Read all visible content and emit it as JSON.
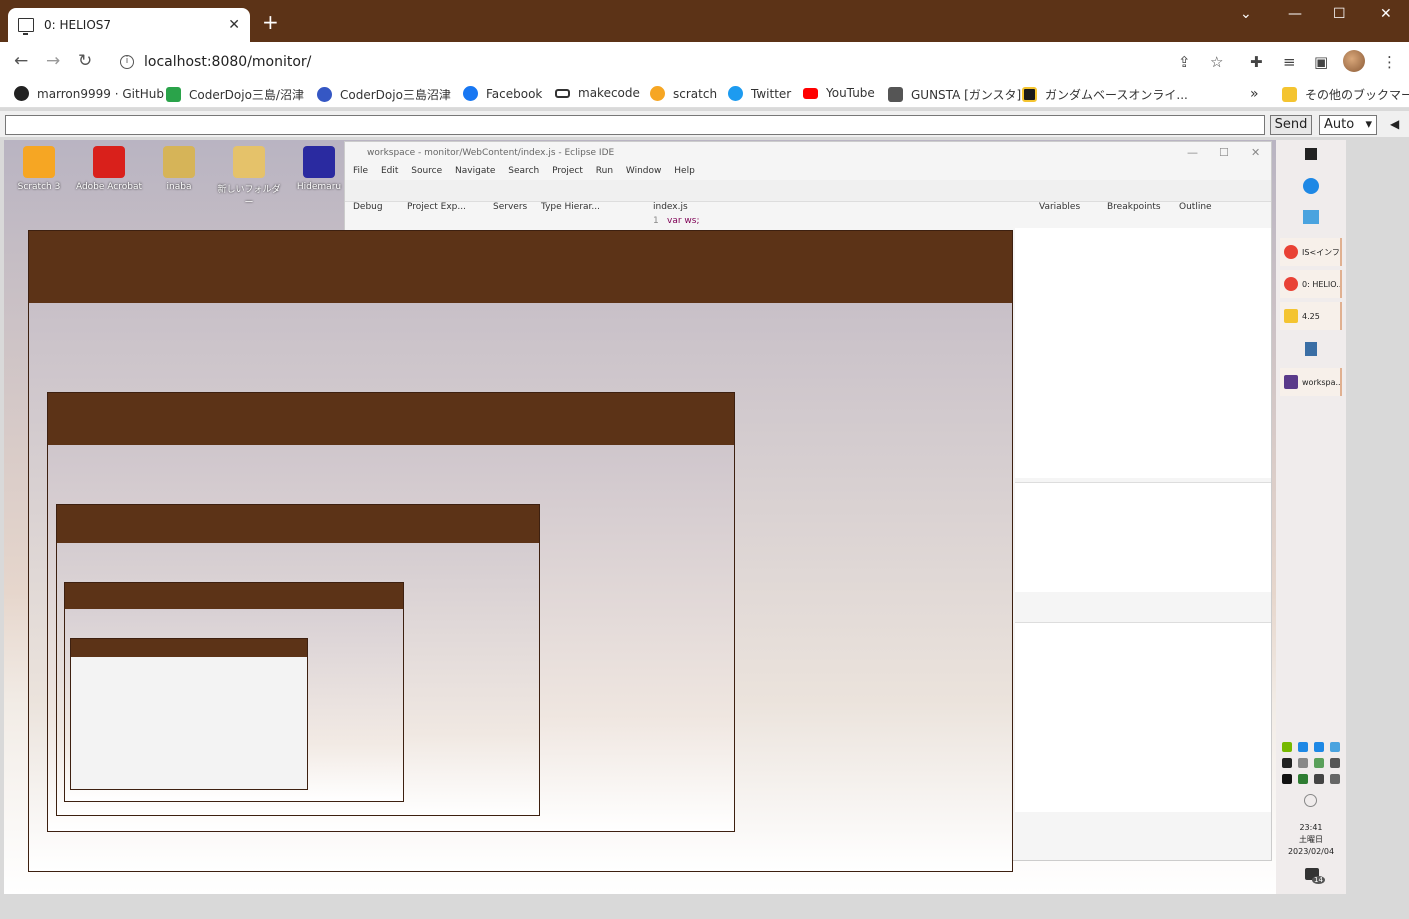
{
  "browser": {
    "tab_title": "0: HELIOS7",
    "tab_close": "✕",
    "new_tab": "+",
    "url": "localhost:8080/monitor/",
    "window_controls": {
      "minimize": "⌄",
      "min": "—",
      "max": "☐",
      "close": "✕"
    }
  },
  "bookmarks": [
    {
      "label": "marron9999 · GitHub",
      "color": "#222"
    },
    {
      "label": "CoderDojo三島/沼津",
      "color": "#2aa34a"
    },
    {
      "label": "CoderDojo三島沼津",
      "color": "#3557c4"
    },
    {
      "label": "Facebook",
      "color": "#1877f2"
    },
    {
      "label": "makecode",
      "color": "#333"
    },
    {
      "label": "scratch",
      "color": "#f6a623"
    },
    {
      "label": "Twitter",
      "color": "#1d9bf0"
    },
    {
      "label": "YouTube",
      "color": "#ff0000"
    },
    {
      "label": "GUNSTA [ガンスタ]",
      "color": "#333"
    },
    {
      "label": "ガンダムベースオンライ...",
      "color": "#1a1a1a"
    }
  ],
  "bookmarks_more": "»",
  "other_bookmarks": "その他のブックマーク",
  "command": {
    "input_value": "",
    "send_label": "Send",
    "mode_value": "Auto",
    "collapse": "◀"
  },
  "desktop_icons": [
    {
      "label": "Scratch 3",
      "color": "#f6a623"
    },
    {
      "label": "Adobe Acrobat",
      "color": "#d9201b"
    },
    {
      "label": "inaba",
      "color": "#d6b458"
    },
    {
      "label": "新しいフォルダー",
      "color": "#e5c26a"
    },
    {
      "label": "Hidemaru",
      "color": "#2a2aa0"
    }
  ],
  "eclipse": {
    "title": "workspace - monitor/WebContent/index.js - Eclipse IDE",
    "menu": [
      "File",
      "Edit",
      "Source",
      "Navigate",
      "Search",
      "Project",
      "Run",
      "Window",
      "Help"
    ],
    "views": [
      "Debug",
      "Project Exp...",
      "Servers",
      "Type Hierar...",
      "index.js",
      "Variables",
      "Breakpoints",
      "Outline"
    ],
    "code_line_no": "1",
    "code": "var ws;"
  },
  "taskbar": {
    "items": [
      {
        "label": "IS<インフ...",
        "color": "#e94235"
      },
      {
        "label": "0: HELIO...",
        "color": "#e94235"
      },
      {
        "label": "4.25",
        "color": "#f4c430"
      },
      {
        "label": "workspa...",
        "color": "#5a3a8a"
      }
    ],
    "time": "23:41",
    "weekday": "土曜日",
    "date": "2023/02/04",
    "notif": "14"
  }
}
